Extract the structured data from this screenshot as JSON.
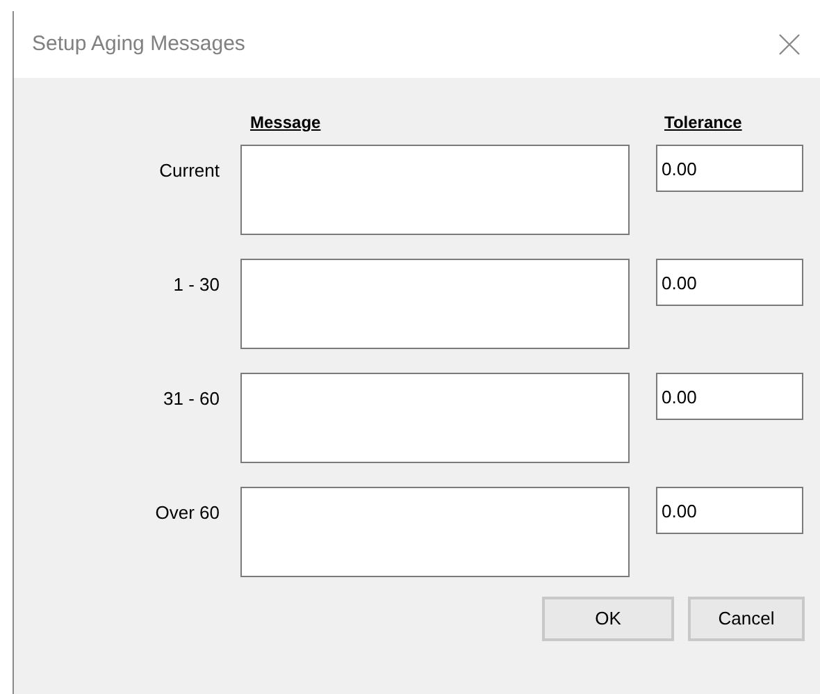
{
  "window": {
    "title": "Setup Aging Messages"
  },
  "columns": [
    "Message",
    "Tolerance"
  ],
  "rows": [
    {
      "label": "Current",
      "message": "",
      "tolerance": "0.00"
    },
    {
      "label": "1 - 30",
      "message": "",
      "tolerance": "0.00"
    },
    {
      "label": "31 - 60",
      "message": "",
      "tolerance": "0.00"
    },
    {
      "label": "Over 60",
      "message": "",
      "tolerance": "0.00"
    }
  ],
  "buttons": [
    "OK",
    "Cancel"
  ]
}
